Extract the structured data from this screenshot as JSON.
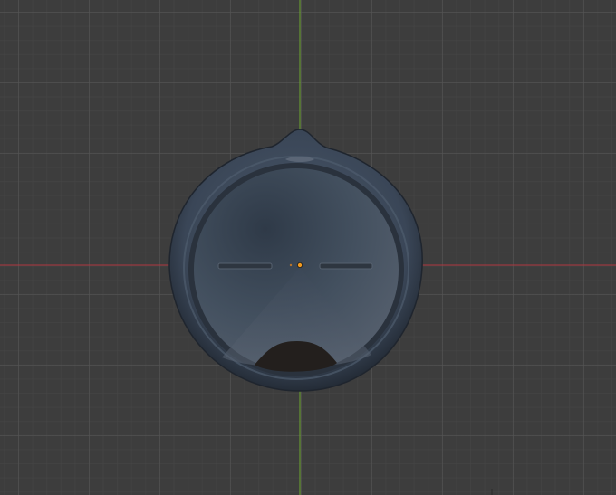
{
  "viewport": {
    "name": "3d-viewport",
    "background": "#3d3d3d",
    "grid_minor_color": "#464646",
    "grid_major_color": "#565656"
  },
  "axes": {
    "x_color": "#b0363f",
    "y_color": "#6da82e"
  },
  "object": {
    "name": "round-lid-mesh",
    "rim_color": "#364252",
    "face_color": "#43505f",
    "slot_color": "#2e3640",
    "notch_color": "#231f1d",
    "origin_color": "#f29a1e"
  }
}
